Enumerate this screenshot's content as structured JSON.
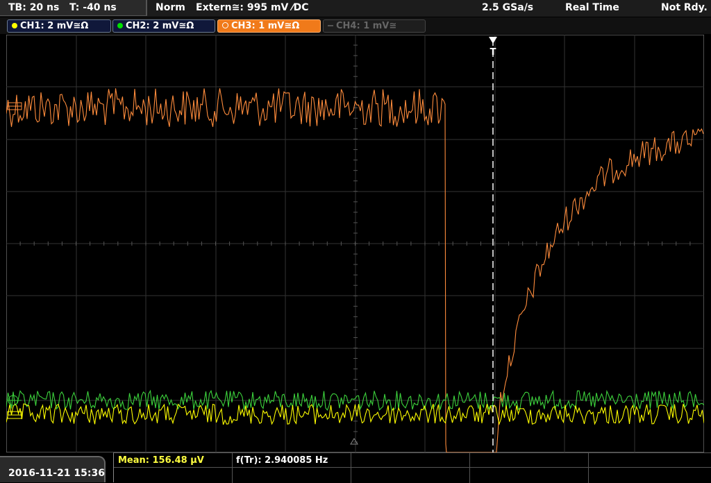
{
  "header": {
    "timebase": "TB: 20 ns",
    "trigger_time": "T: -40 ns",
    "mode": "Norm",
    "trigger_source": "Extern≅: 995 mV ⁄DC",
    "sample_rate": "2.5 GSa/s",
    "acquisition": "Real Time",
    "status": "Not Rdy."
  },
  "channels": [
    {
      "label": "CH1: 2 mV≅Ω",
      "color": "#ffff00",
      "state": "on"
    },
    {
      "label": "CH2: 2 mV≅Ω",
      "color": "#00e000",
      "state": "on"
    },
    {
      "label": "CH3: 1 mV≅Ω",
      "color": "#ff8020",
      "state": "selected"
    },
    {
      "label": "CH4: 1 mV≅",
      "color": "#777777",
      "state": "off"
    }
  ],
  "trigger_marker": "T",
  "footer": {
    "datetime": "2016-11-21 15:36",
    "measurement_1": "Mean: 156.48 µV",
    "measurement_2": "f(Tr): 2.940085 Hz"
  },
  "colors": {
    "ch1": "#ffff00",
    "ch2": "#3cd23c",
    "ch3": "#ff8c3c",
    "grid": "#3a3a3a",
    "meas_highlight": "#ffff40"
  }
}
